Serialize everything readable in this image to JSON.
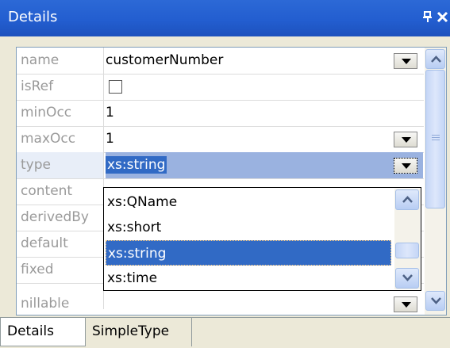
{
  "window": {
    "title": "Details",
    "title_bar_color": "#235ed0",
    "icons": [
      "pin-icon",
      "close-icon"
    ]
  },
  "properties": [
    {
      "label": "name",
      "value": "customerNumber",
      "control": "dropdown"
    },
    {
      "label": "isRef",
      "value": "",
      "control": "checkbox",
      "checked": false
    },
    {
      "label": "minOcc",
      "value": "1",
      "control": "text"
    },
    {
      "label": "maxOcc",
      "value": "1",
      "control": "dropdown"
    },
    {
      "label": "type",
      "value": "xs:string",
      "control": "dropdown",
      "selected": true
    },
    {
      "label": "content",
      "value": "",
      "control": "text"
    },
    {
      "label": "derivedBy",
      "value": "",
      "control": "text"
    },
    {
      "label": "default",
      "value": "",
      "control": "text"
    },
    {
      "label": "fixed",
      "value": "",
      "control": "text"
    },
    {
      "label": "nillable",
      "value": "",
      "control": "dropdown"
    }
  ],
  "type_dropdown": {
    "options": [
      "xs:QName",
      "xs:short",
      "xs:string",
      "xs:time"
    ],
    "highlighted": "xs:string",
    "highlight_color": "#316ac5"
  },
  "tabs": [
    {
      "label": "Details",
      "active": true
    },
    {
      "label": "SimpleType",
      "active": false
    }
  ]
}
